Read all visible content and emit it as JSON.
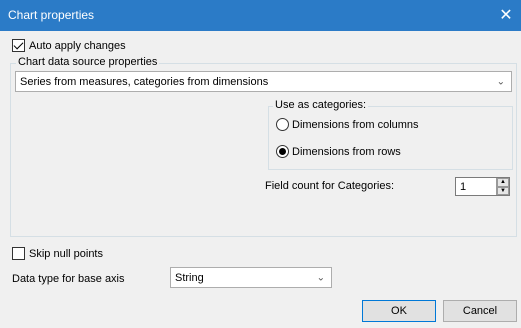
{
  "window": {
    "title": "Chart properties",
    "close_glyph": "✕"
  },
  "auto_apply": {
    "label": "Auto apply changes",
    "checked": true
  },
  "data_source": {
    "group_label": "Chart data source properties",
    "selected": "Series from measures, categories from dimensions",
    "use_as_categories": {
      "label": "Use as categories:",
      "options": [
        "Dimensions from columns",
        "Dimensions from rows"
      ],
      "selected_index": 1
    },
    "field_count": {
      "label": "Field count for Categories:",
      "value": "1"
    }
  },
  "skip_null": {
    "label": "Skip null points",
    "checked": false
  },
  "base_axis": {
    "label": "Data type for base axis",
    "selected": "String"
  },
  "buttons": {
    "ok": "OK",
    "cancel": "Cancel"
  }
}
